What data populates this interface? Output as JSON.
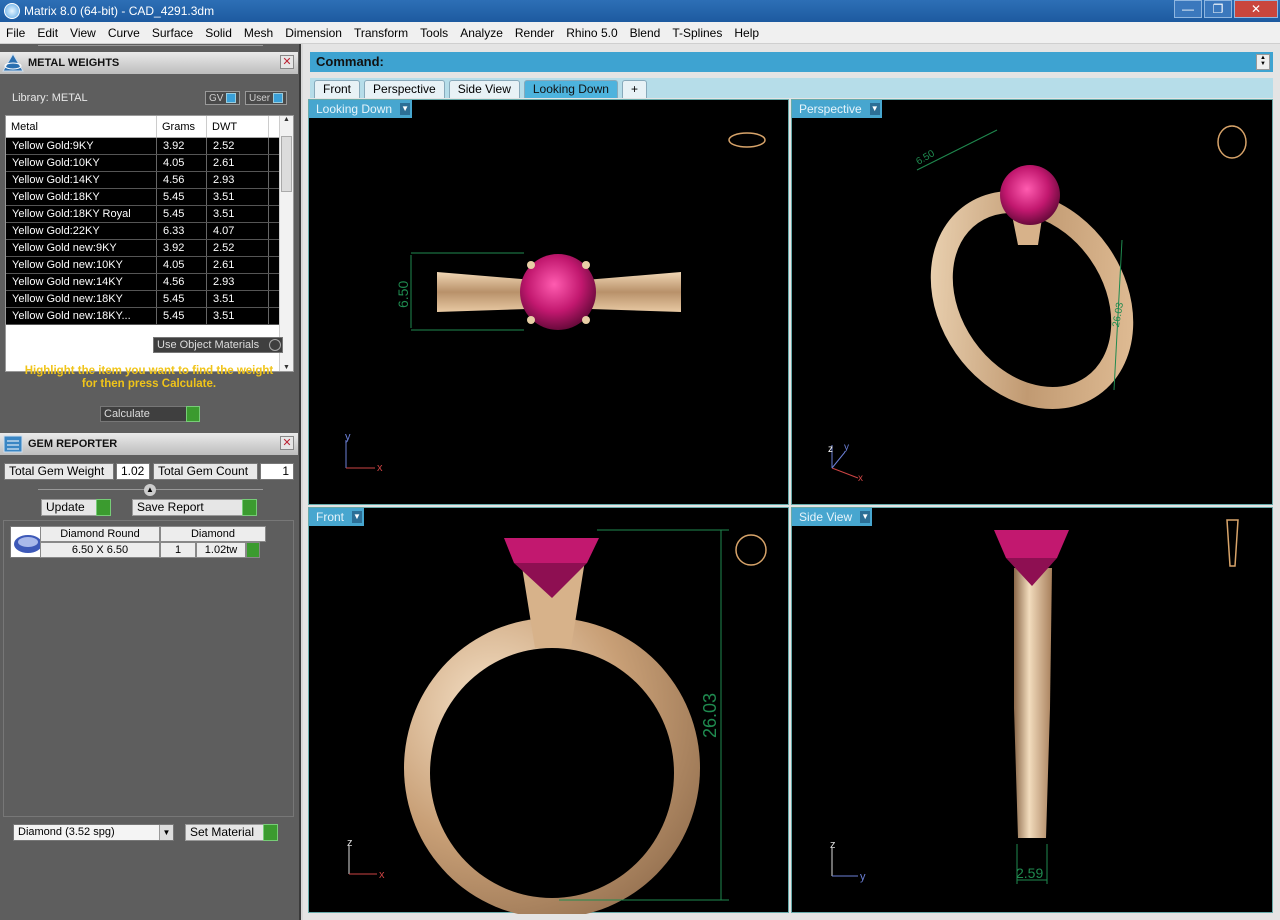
{
  "window": {
    "title": "Matrix 8.0 (64-bit) - CAD_4291.3dm",
    "min": "—",
    "max": "❐",
    "close": "✕"
  },
  "menu": [
    "File",
    "Edit",
    "View",
    "Curve",
    "Surface",
    "Solid",
    "Mesh",
    "Dimension",
    "Transform",
    "Tools",
    "Analyze",
    "Render",
    "Rhino 5.0",
    "Blend",
    "T-Splines",
    "Help"
  ],
  "metal_weights": {
    "title": "METAL WEIGHTS",
    "library": "Library: METAL",
    "toggle_gv": "GV",
    "toggle_user": "User",
    "columns": [
      "Metal",
      "Grams",
      "DWT"
    ],
    "rows": [
      [
        "Yellow Gold:9KY",
        "3.92",
        "2.52"
      ],
      [
        "Yellow Gold:10KY",
        "4.05",
        "2.61"
      ],
      [
        "Yellow Gold:14KY",
        "4.56",
        "2.93"
      ],
      [
        "Yellow Gold:18KY",
        "5.45",
        "3.51"
      ],
      [
        "Yellow Gold:18KY Royal",
        "5.45",
        "3.51"
      ],
      [
        "Yellow Gold:22KY",
        "6.33",
        "4.07"
      ],
      [
        "Yellow Gold new:9KY",
        "3.92",
        "2.52"
      ],
      [
        "Yellow Gold new:10KY",
        "4.05",
        "2.61"
      ],
      [
        "Yellow Gold new:14KY",
        "4.56",
        "2.93"
      ],
      [
        "Yellow Gold new:18KY",
        "5.45",
        "3.51"
      ],
      [
        "Yellow Gold new:18KY...",
        "5.45",
        "3.51"
      ]
    ],
    "use_object_materials": "Use Object Materials",
    "hint_line1": "Highlight the item you want to find the weight",
    "hint_line2": "for then press Calculate.",
    "calculate": "Calculate"
  },
  "gem_reporter": {
    "title": "GEM REPORTER",
    "total_weight_label": "Total Gem Weight",
    "total_weight_value": "1.02",
    "total_count_label": "Total Gem Count",
    "total_count_value": "1",
    "update": "Update",
    "save_report": "Save Report",
    "gem": {
      "shape": "Diamond Round",
      "type": "Diamond",
      "size": "6.50 X 6.50",
      "count": "1",
      "weight": "1.02tw"
    },
    "material_select": "Diamond      (3.52 spg)",
    "set_material": "Set Material"
  },
  "command": {
    "label": "Command:"
  },
  "tabs": [
    "Front",
    "Perspective",
    "Side View",
    "Looking Down"
  ],
  "tab_add": "+",
  "active_tab": "Looking Down",
  "viewports": {
    "top_left": {
      "label": "Looking Down",
      "dim": "6.50",
      "axis_v": "y",
      "axis_h": "x"
    },
    "top_right": {
      "label": "Perspective",
      "dim1": "6.50",
      "dim2": "26.03",
      "axis_z": "z",
      "axis_y": "y",
      "axis_x": "x"
    },
    "bottom_left": {
      "label": "Front",
      "dim": "26.03",
      "axis_v": "z",
      "axis_h": "x"
    },
    "bottom_right": {
      "label": "Side View",
      "dim": "2.59",
      "axis_v": "z",
      "axis_h": "y"
    }
  },
  "colors": {
    "gold": "#d8b58f",
    "gem": "#c2186f",
    "dim": "#1f8a4f",
    "panel": "#5e5e5e",
    "accent": "#47a6cf"
  }
}
